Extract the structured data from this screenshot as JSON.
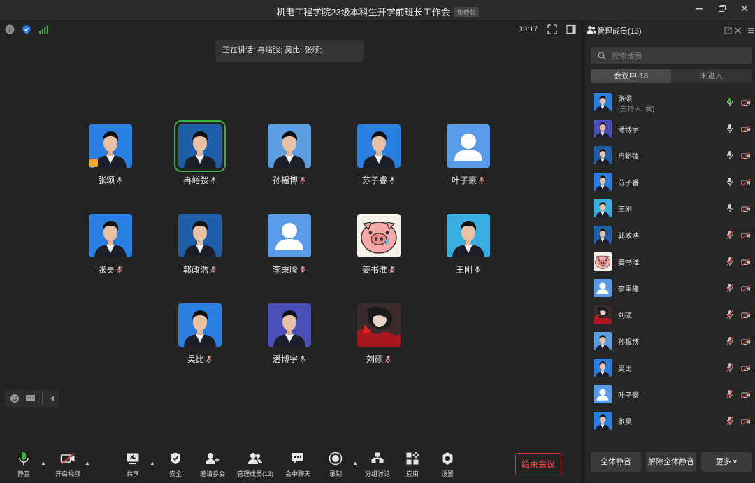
{
  "window": {
    "title": "机电工程学院23级本科生开学前班长工作会",
    "badge": "免费版",
    "minimize_icon": "minimize-icon",
    "restore_icon": "restore-icon",
    "close_icon": "close-icon"
  },
  "meeting": {
    "speaking_banner": "正在讲话: 冉峪弢; 吴比; 张颂;",
    "clock": "10:17"
  },
  "participants": [
    {
      "name": "张颂",
      "mic": "on",
      "avatar": "photo-blue",
      "host": true
    },
    {
      "name": "冉峪弢",
      "mic": "on",
      "avatar": "photo-blue-dark",
      "active": true
    },
    {
      "name": "孙韫博",
      "mic": "muted",
      "avatar": "photo-light"
    },
    {
      "name": "苏子睿",
      "mic": "on",
      "avatar": "photo-blue"
    },
    {
      "name": "叶子豪",
      "mic": "muted",
      "avatar": "default-user"
    },
    {
      "name": "张昊",
      "mic": "muted",
      "avatar": "photo-blue"
    },
    {
      "name": "郭政浩",
      "mic": "muted",
      "avatar": "photo-blue-dark"
    },
    {
      "name": "李秉隆",
      "mic": "muted",
      "avatar": "default-user"
    },
    {
      "name": "姜书淮",
      "mic": "muted",
      "avatar": "pig-cartoon"
    },
    {
      "name": "王刚",
      "mic": "on",
      "avatar": "photo-cyan"
    },
    {
      "name": "吴比",
      "mic": "muted",
      "avatar": "photo-blue"
    },
    {
      "name": "潘博宇",
      "mic": "on",
      "avatar": "photo-purple"
    },
    {
      "name": "刘硕",
      "mic": "muted",
      "avatar": "anime-red"
    }
  ],
  "toolbar": {
    "mute": "静音",
    "video": "开启视频",
    "share": "共享",
    "security": "安全",
    "invite": "邀请参会",
    "members": "管理成员(13)",
    "chat": "会中聊天",
    "record": "录制",
    "breakout": "分组讨论",
    "apps": "应用",
    "settings": "设置",
    "end": "结束会议"
  },
  "sidebar": {
    "title": "管理成员(13)",
    "search_placeholder": "搜索成员",
    "tab_in": "会议中·13",
    "tab_out": "未进入",
    "members": [
      {
        "name": "张颂",
        "sub": "(主持人, 我)",
        "mic": "speaking",
        "avatar": "photo-blue"
      },
      {
        "name": "潘博宇",
        "mic": "on",
        "avatar": "photo-purple"
      },
      {
        "name": "冉峪弢",
        "mic": "on",
        "avatar": "photo-blue-dark"
      },
      {
        "name": "苏子睿",
        "mic": "on",
        "avatar": "photo-blue"
      },
      {
        "name": "王刚",
        "mic": "on",
        "avatar": "photo-cyan"
      },
      {
        "name": "郭政浩",
        "mic": "muted",
        "avatar": "photo-blue-dark"
      },
      {
        "name": "姜书淮",
        "mic": "muted",
        "avatar": "pig-cartoon"
      },
      {
        "name": "李秉隆",
        "mic": "muted",
        "avatar": "default-user"
      },
      {
        "name": "刘硕",
        "mic": "muted",
        "avatar": "anime-red"
      },
      {
        "name": "孙韫博",
        "mic": "muted",
        "avatar": "photo-light"
      },
      {
        "name": "吴比",
        "mic": "muted",
        "avatar": "photo-blue"
      },
      {
        "name": "叶子豪",
        "mic": "muted",
        "avatar": "default-user"
      },
      {
        "name": "张昊",
        "mic": "muted",
        "avatar": "photo-blue"
      }
    ],
    "mute_all": "全体静音",
    "unmute_all": "解除全体静音",
    "more": "更多 ▾"
  },
  "colors": {
    "accent_green": "#3cb043",
    "end_red": "#ff4d4d",
    "mute_red": "#e0403a",
    "avatar_blue": "#2a7fe0"
  }
}
